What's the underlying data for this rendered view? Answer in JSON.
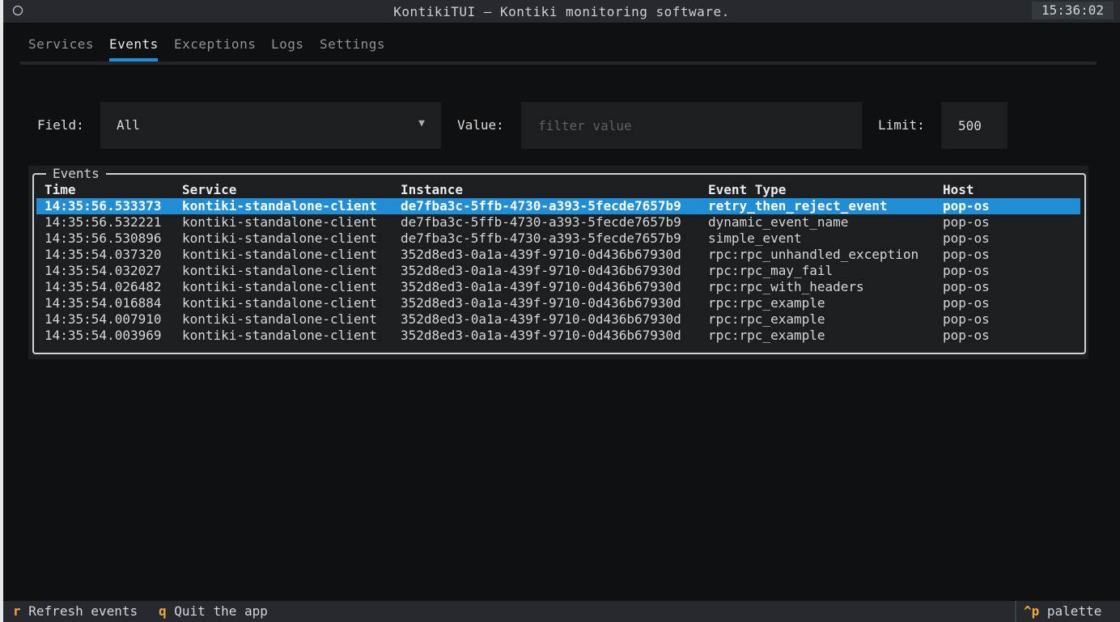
{
  "app": {
    "title": "KontikiTUI — Kontiki monitoring software.",
    "clock": "15:36:02"
  },
  "tabs": [
    {
      "label": "Services",
      "active": false
    },
    {
      "label": "Events",
      "active": true
    },
    {
      "label": "Exceptions",
      "active": false
    },
    {
      "label": "Logs",
      "active": false
    },
    {
      "label": "Settings",
      "active": false
    }
  ],
  "filters": {
    "field_label": "Field:",
    "field_value": "All",
    "value_label": "Value:",
    "value_placeholder": "filter value",
    "limit_label": "Limit:",
    "limit_value": "500"
  },
  "events": {
    "legend": "Events",
    "columns": [
      "Time",
      "Service",
      "Instance",
      "Event Type",
      "Host"
    ],
    "selected_index": 0,
    "rows": [
      [
        "14:35:56.533373",
        "kontiki-standalone-client",
        "de7fba3c-5ffb-4730-a393-5fecde7657b9",
        "retry_then_reject_event",
        "pop-os"
      ],
      [
        "14:35:56.532221",
        "kontiki-standalone-client",
        "de7fba3c-5ffb-4730-a393-5fecde7657b9",
        "dynamic_event_name",
        "pop-os"
      ],
      [
        "14:35:56.530896",
        "kontiki-standalone-client",
        "de7fba3c-5ffb-4730-a393-5fecde7657b9",
        "simple_event",
        "pop-os"
      ],
      [
        "14:35:54.037320",
        "kontiki-standalone-client",
        "352d8ed3-0a1a-439f-9710-0d436b67930d",
        "rpc:rpc_unhandled_exception",
        "pop-os"
      ],
      [
        "14:35:54.032027",
        "kontiki-standalone-client",
        "352d8ed3-0a1a-439f-9710-0d436b67930d",
        "rpc:rpc_may_fail",
        "pop-os"
      ],
      [
        "14:35:54.026482",
        "kontiki-standalone-client",
        "352d8ed3-0a1a-439f-9710-0d436b67930d",
        "rpc:rpc_with_headers",
        "pop-os"
      ],
      [
        "14:35:54.016884",
        "kontiki-standalone-client",
        "352d8ed3-0a1a-439f-9710-0d436b67930d",
        "rpc:rpc_example",
        "pop-os"
      ],
      [
        "14:35:54.007910",
        "kontiki-standalone-client",
        "352d8ed3-0a1a-439f-9710-0d436b67930d",
        "rpc:rpc_example",
        "pop-os"
      ],
      [
        "14:35:54.003969",
        "kontiki-standalone-client",
        "352d8ed3-0a1a-439f-9710-0d436b67930d",
        "rpc:rpc_example",
        "pop-os"
      ]
    ]
  },
  "footer": {
    "bindings": [
      {
        "key": "r",
        "label": "Refresh events"
      },
      {
        "key": "q",
        "label": "Quit the app"
      }
    ],
    "palette": {
      "key": "^p",
      "label": "palette"
    }
  },
  "colors": {
    "accent": "#1f8ed6",
    "key": "#f2a533",
    "background": "#0f1011",
    "panel": "#1c1e20"
  },
  "icons": {
    "dropdown": "triangle-down-icon",
    "app": "circle-icon"
  }
}
